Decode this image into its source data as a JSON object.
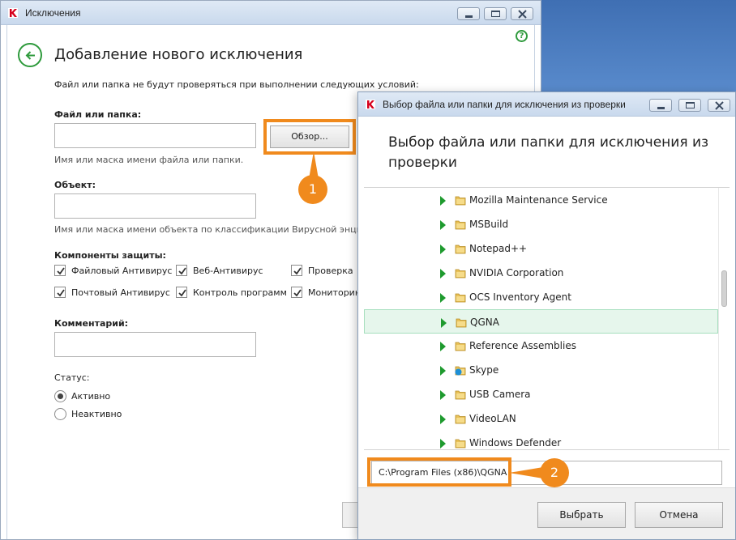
{
  "main_window": {
    "title": "Исключения",
    "heading": "Добавление нового исключения",
    "description": "Файл или папка не будут проверяться при выполнении следующих условий:",
    "file_label": "Файл или папка:",
    "file_value": "",
    "browse_label": "Обзор...",
    "file_hint": "Имя или маска имени файла или папки.",
    "object_label": "Объект:",
    "object_value": "",
    "object_hint": "Имя или маска имени объекта по классификации Вирусной энцикл",
    "components_label": "Компоненты защиты:",
    "components": [
      {
        "label": "Файловый Антивирус",
        "checked": true
      },
      {
        "label": "Веб-Антивирус",
        "checked": true
      },
      {
        "label": "Проверка",
        "checked": true
      },
      {
        "label": "Почтовый Антивирус",
        "checked": true
      },
      {
        "label": "Контроль программ",
        "checked": true
      },
      {
        "label": "Мониторин",
        "checked": true
      }
    ],
    "comment_label": "Комментарий:",
    "comment_value": "",
    "status_label": "Статус:",
    "status_options": [
      {
        "label": "Активно",
        "selected": true
      },
      {
        "label": "Неактивно",
        "selected": false
      }
    ],
    "help_glyph": "?"
  },
  "dialog": {
    "title": "Выбор файла или папки для исключения из проверки",
    "heading": "Выбор файла или папки для исключения из проверки",
    "tree_items": [
      {
        "label": "Mozilla Maintenance Service",
        "selected": false,
        "icon": "folder-icon"
      },
      {
        "label": "MSBuild",
        "selected": false,
        "icon": "folder-icon"
      },
      {
        "label": "Notepad++",
        "selected": false,
        "icon": "folder-icon"
      },
      {
        "label": "NVIDIA Corporation",
        "selected": false,
        "icon": "folder-icon"
      },
      {
        "label": "OCS Inventory Agent",
        "selected": false,
        "icon": "folder-icon"
      },
      {
        "label": "QGNA",
        "selected": true,
        "icon": "folder-icon"
      },
      {
        "label": "Reference Assemblies",
        "selected": false,
        "icon": "folder-icon"
      },
      {
        "label": "Skype",
        "selected": false,
        "icon": "skype-folder-icon"
      },
      {
        "label": "USB Camera",
        "selected": false,
        "icon": "folder-icon"
      },
      {
        "label": "VideoLAN",
        "selected": false,
        "icon": "folder-icon"
      },
      {
        "label": "Windows Defender",
        "selected": false,
        "icon": "folder-icon"
      }
    ],
    "path_value": "C:\\Program Files (x86)\\QGNA",
    "select_label": "Выбрать",
    "cancel_label": "Отмена"
  },
  "annotations": {
    "step1": "1",
    "step2": "2"
  },
  "colors": {
    "accent_green": "#2e9a3c",
    "highlight_orange": "#f08a1d",
    "selection_bg": "#e6f6ec"
  }
}
